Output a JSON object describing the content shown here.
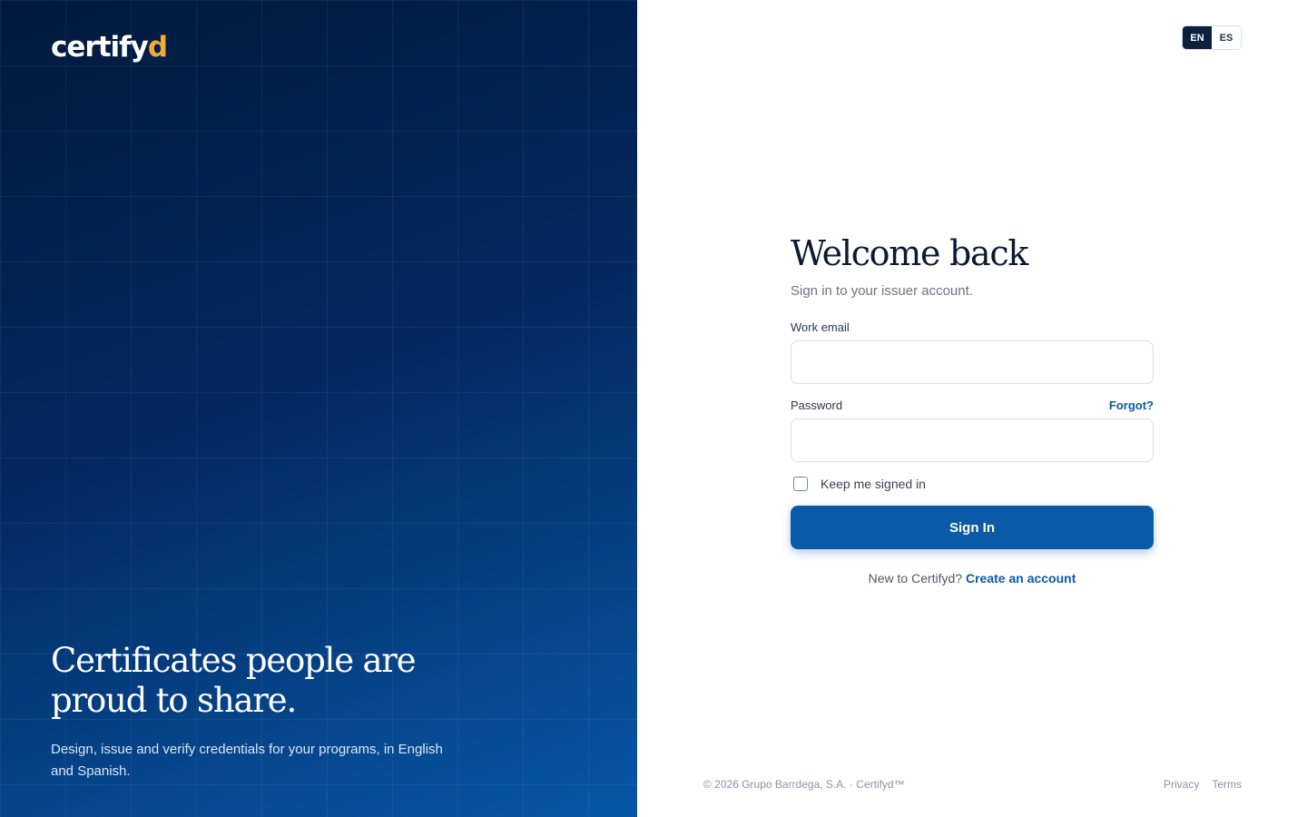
{
  "hero": {
    "logo_main": "certify",
    "logo_accent": "d",
    "headline": "Certificates people are proud to share.",
    "subtext": "Design, issue and verify credentials for your programs, in English and Spanish."
  },
  "lang": {
    "en": "EN",
    "es": "ES",
    "active": "EN"
  },
  "form": {
    "title": "Welcome back",
    "subtitle": "Sign in to your issuer account.",
    "email_label": "Work email",
    "email_value": "",
    "password_label": "Password",
    "password_value": "",
    "forgot_link": "Forgot?",
    "remember_label": "Keep me signed in",
    "remember_checked": false,
    "signin_button": "Sign In",
    "signup_prompt": "New to Certifyd?",
    "signup_link": "Create an account"
  },
  "footer": {
    "copyright": "© 2026 Grupo Barrdega, S.A. · Certifyd™",
    "privacy": "Privacy",
    "terms": "Terms"
  },
  "colors": {
    "brand_navy": "#0b1f3f",
    "brand_blue": "#0a5aa7",
    "logo_accent": "#f2a93b"
  }
}
